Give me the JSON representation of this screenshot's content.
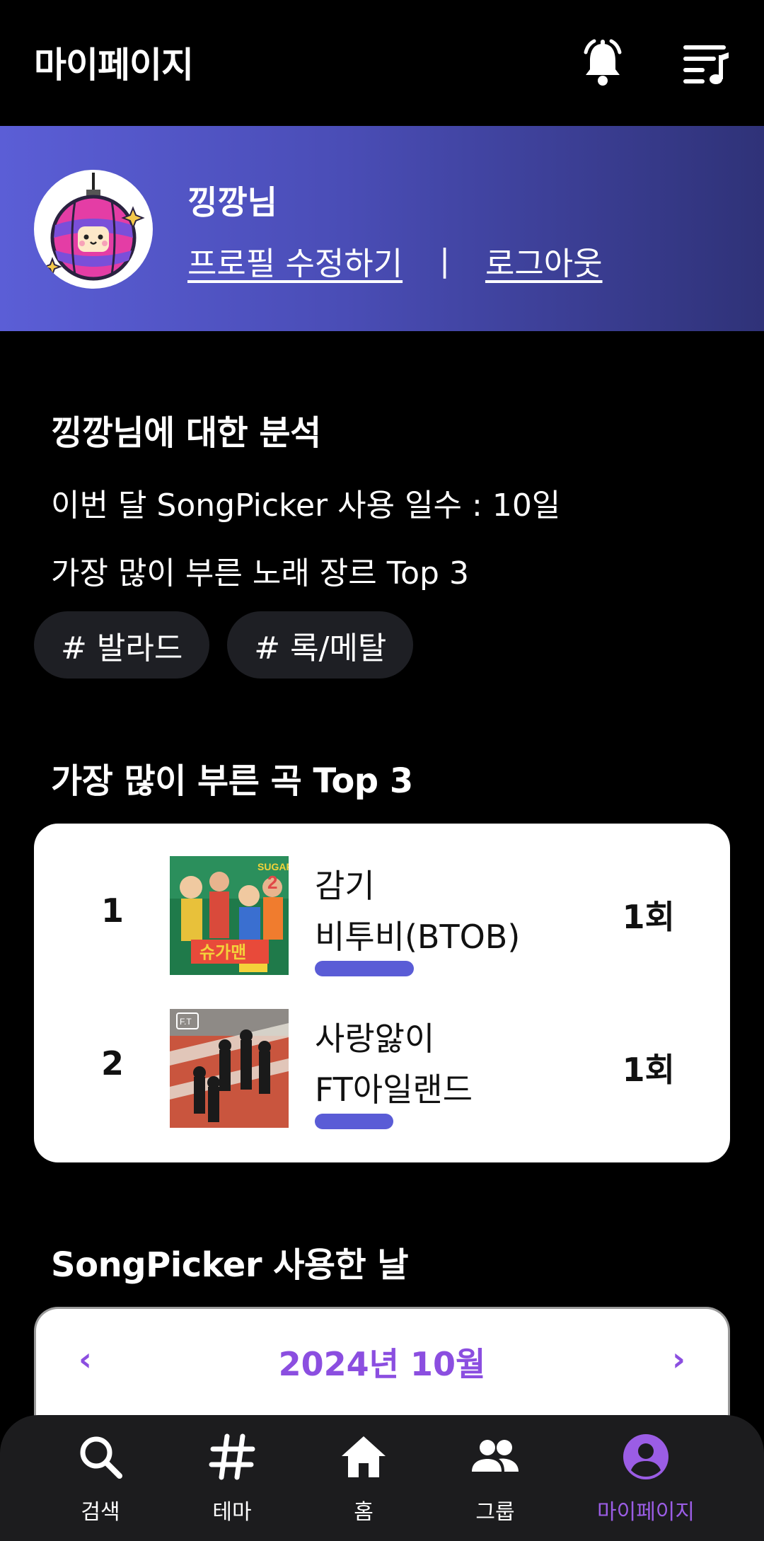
{
  "header": {
    "title": "마이페이지",
    "bell_icon": "bell-icon",
    "queue_icon": "music-queue-icon"
  },
  "profile": {
    "nickname": "낑깡님",
    "edit_link": "프로필 수정하기",
    "separator": "|",
    "logout_link": "로그아웃",
    "avatar_icon": "disco-ball-avatar"
  },
  "analysis": {
    "title": "낑깡님에 대한 분석",
    "usage_line": "이번 달 SongPicker 사용 일수 : 10일",
    "genre_line": "가장 많이 부른 노래 장르 Top 3",
    "genres": [
      "# 발라드",
      "# 록/메탈"
    ]
  },
  "top_songs": {
    "title": "가장 많이 부른 곡 Top 3",
    "items": [
      {
        "rank": "1",
        "title": "감기",
        "artist": "비투비(BTOB)",
        "count": "1회",
        "bar_fraction": 1.0
      },
      {
        "rank": "2",
        "title": "사랑앓이",
        "artist": "FT아일랜드",
        "count": "1회",
        "bar_fraction": 0.79
      }
    ],
    "bar_color": "#5a5cd6"
  },
  "calendar": {
    "title": "SongPicker 사용한 날",
    "prev": "‹",
    "month": "2024년 10월",
    "next": "›",
    "accent": "#8b4ee0"
  },
  "nav": {
    "items": [
      {
        "label": "검색",
        "icon": "search-icon"
      },
      {
        "label": "테마",
        "icon": "hashtag-icon"
      },
      {
        "label": "홈",
        "icon": "home-icon"
      },
      {
        "label": "그룹",
        "icon": "group-icon"
      },
      {
        "label": "마이페이지",
        "icon": "account-icon"
      }
    ],
    "active_index": 4,
    "active_color": "#9b5de5"
  }
}
